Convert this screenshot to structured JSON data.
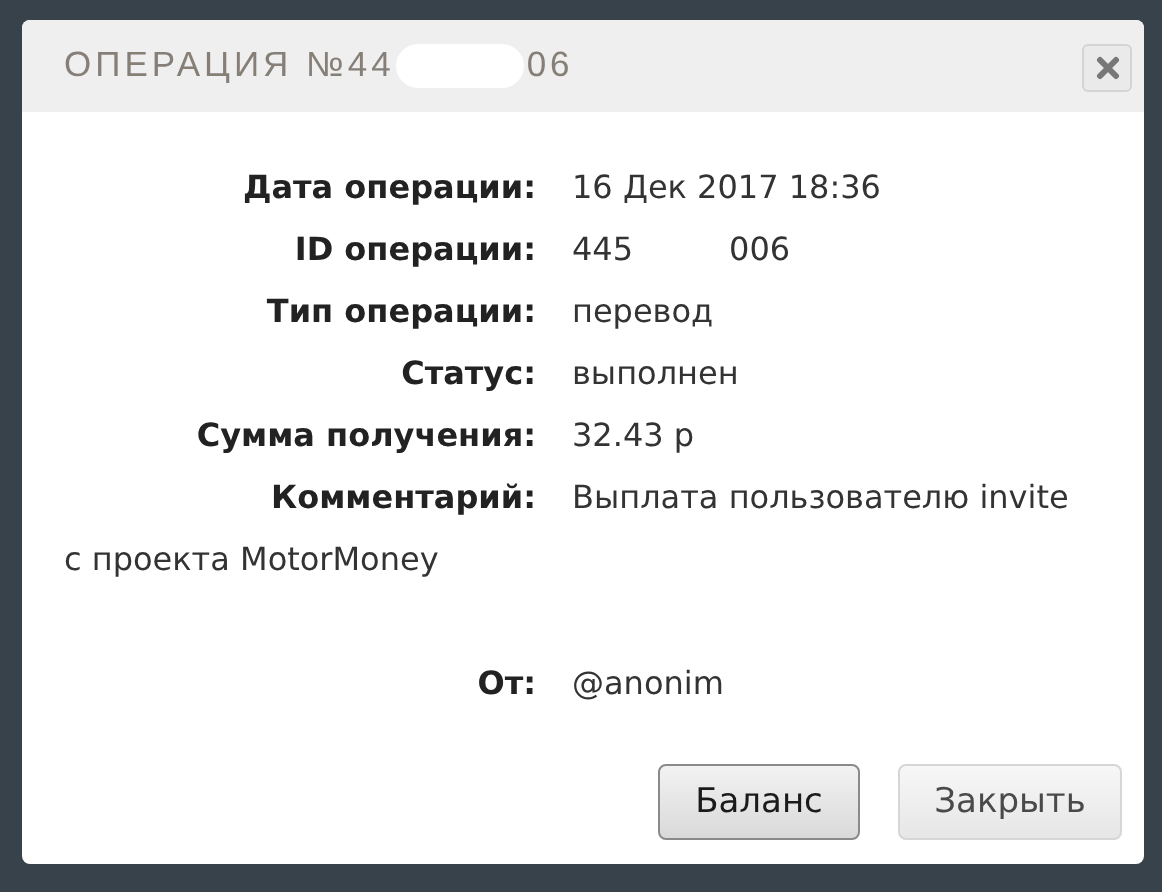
{
  "dialog": {
    "title_start": "ОПЕРАЦИЯ №44",
    "title_end": "06"
  },
  "fields": [
    {
      "label": "Дата операции:",
      "value": [
        "16 Дек 2017 18:36"
      ]
    },
    {
      "label": "ID операции:",
      "value": [
        "445",
        "006"
      ]
    },
    {
      "label": "Тип операции:",
      "value": [
        "перевод"
      ]
    },
    {
      "label": "Статус:",
      "value": [
        "выполнен"
      ]
    },
    {
      "label": "Сумма получения:",
      "value": [
        "32.43 р"
      ]
    },
    {
      "label": "Комментарий:",
      "value": [
        "Выплата пользователю invite"
      ],
      "continuation": "с проекта MotorMoney"
    }
  ],
  "sender": {
    "label": "От:",
    "value": "@anonim"
  },
  "buttons": [
    {
      "label": "Баланс",
      "kind": "primary"
    },
    {
      "label": "Закрыть",
      "kind": "secondary"
    }
  ]
}
